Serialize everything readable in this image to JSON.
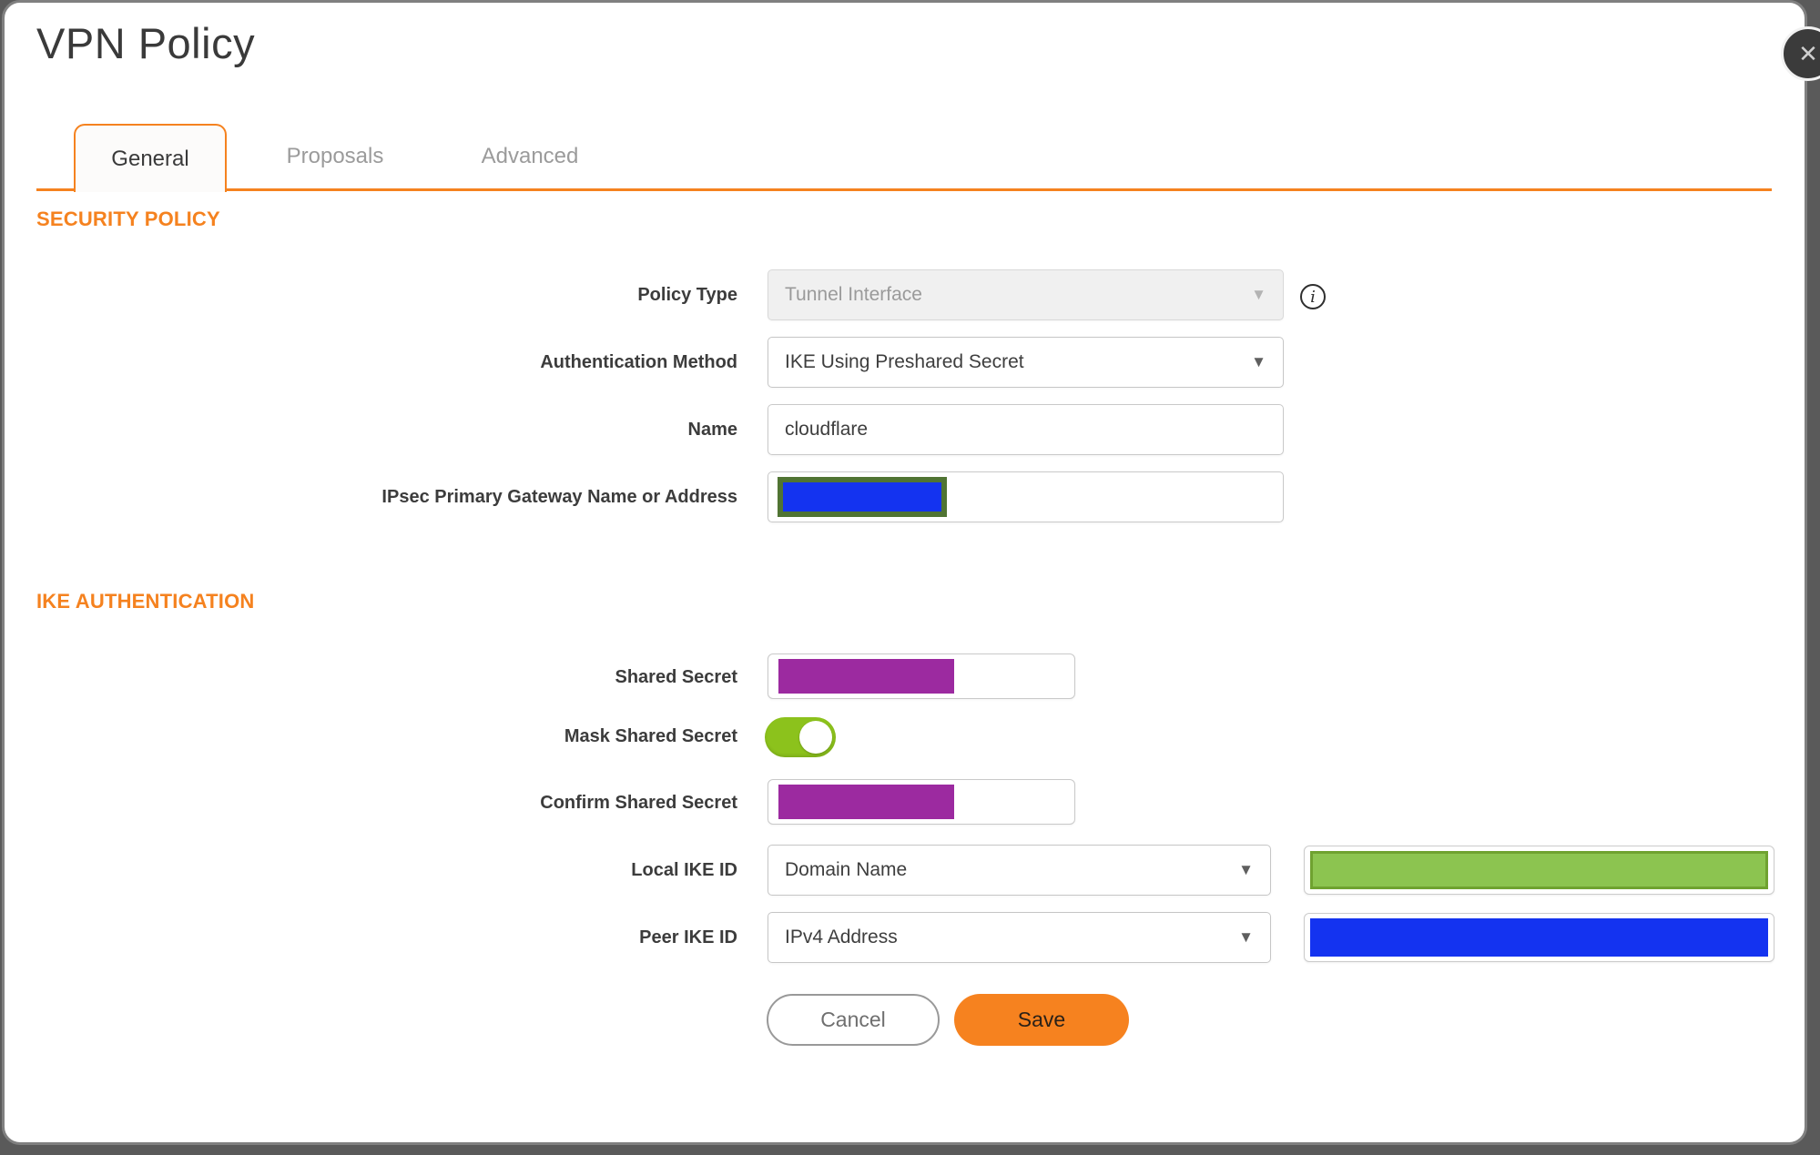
{
  "dialog": {
    "title": "VPN Policy"
  },
  "icons": {
    "close": "✕",
    "caret": "▼",
    "info": "i"
  },
  "tabs": [
    {
      "label": "General",
      "active": true
    },
    {
      "label": "Proposals",
      "active": false
    },
    {
      "label": "Advanced",
      "active": false
    }
  ],
  "sections": {
    "security_policy": {
      "heading": "SECURITY POLICY"
    },
    "ike_authentication": {
      "heading": "IKE AUTHENTICATION"
    }
  },
  "fields": {
    "policy_type": {
      "label": "Policy Type",
      "value": "Tunnel Interface",
      "disabled": true
    },
    "authentication_method": {
      "label": "Authentication Method",
      "value": "IKE Using Preshared Secret"
    },
    "name": {
      "label": "Name",
      "value": "cloudflare"
    },
    "ipsec_primary_gateway": {
      "label": "IPsec Primary Gateway Name or Address",
      "value": "",
      "redacted": true,
      "redaction_color": "#1433f0"
    },
    "shared_secret": {
      "label": "Shared Secret",
      "value": "",
      "redacted": true,
      "redaction_color": "#9c2aa0"
    },
    "mask_shared_secret": {
      "label": "Mask Shared Secret",
      "enabled": true
    },
    "confirm_shared_secret": {
      "label": "Confirm Shared Secret",
      "value": "",
      "redacted": true,
      "redaction_color": "#9c2aa0"
    },
    "local_ike_id": {
      "label": "Local IKE ID",
      "type_value": "Domain Name",
      "value_redaction_color": "#8cc450"
    },
    "peer_ike_id": {
      "label": "Peer IKE ID",
      "type_value": "IPv4 Address",
      "value_redaction_color": "#1433f0"
    }
  },
  "buttons": {
    "cancel": "Cancel",
    "save": "Save"
  },
  "colors": {
    "accent_orange": "#f5821f",
    "toggle_green": "#8cc21c",
    "redaction_purple": "#9c2aa0",
    "redaction_blue": "#1433f0",
    "redaction_green": "#8cc450",
    "redaction_olive_border": "#507433",
    "backdrop_gray": "#5a5a5a"
  }
}
